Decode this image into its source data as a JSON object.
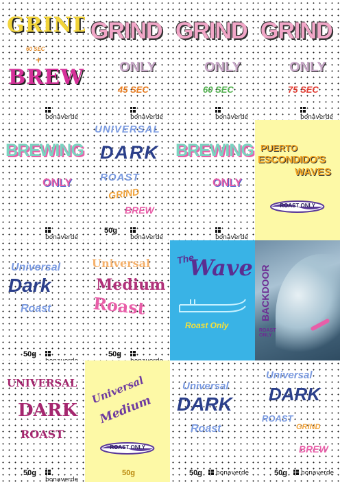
{
  "brand": "bonaverde",
  "cards": {
    "c1": {
      "title_top": "GRIND",
      "subtitle": "60 SEC",
      "title_bottom": "BREW"
    },
    "c2": {
      "title": "GRIND",
      "sub": "ONLY",
      "time": "45 SEC"
    },
    "c3": {
      "title": "GRIND",
      "sub": "ONLY",
      "time": "60 SEC"
    },
    "c4": {
      "title": "GRIND",
      "sub": "ONLY",
      "time": "75 SEC"
    },
    "c5": {
      "title": "BREWING",
      "sub": "ONLY"
    },
    "c6": {
      "l1": "UNIVERSAL",
      "l2": "DARK",
      "l3": "ROAST",
      "l4": "GRIND",
      "l5": "BREW",
      "weight": "50g"
    },
    "c7": {
      "title": "BREWING",
      "sub": "ONLY"
    },
    "c8": {
      "l1": "PUERTO",
      "l2": "ESCONDIDO'S",
      "l3": "WAVES",
      "badge": "ROAST ONLY"
    },
    "c9": {
      "l1": "Universal",
      "l2": "Dark",
      "l3": "Roast",
      "weight": "50g"
    },
    "c10": {
      "l1": "Universal",
      "l2": "Medium",
      "l3": "Roast",
      "weight": "50g"
    },
    "c11": {
      "l1": "The",
      "l2": "Wave",
      "l3": "Roast Only"
    },
    "c12": {
      "l1": "BACKDOOR",
      "l2": "ROAST ONLY"
    },
    "c13": {
      "l1": "UNIVERSAL",
      "l2": "DARK",
      "l3": "ROAST",
      "weight": "50g"
    },
    "c14": {
      "l1": "Universal",
      "l2": "Medium",
      "badge": "ROAST ONLY",
      "weight": "50g"
    },
    "c15": {
      "l1": "Universal",
      "l2": "DARK",
      "l3": "Roast",
      "weight": "50g"
    },
    "c16": {
      "l1": "Universal",
      "l2": "DARK",
      "l3": "ROAST",
      "l4": "GRIND",
      "l5": "BREW",
      "weight": "50g"
    }
  }
}
